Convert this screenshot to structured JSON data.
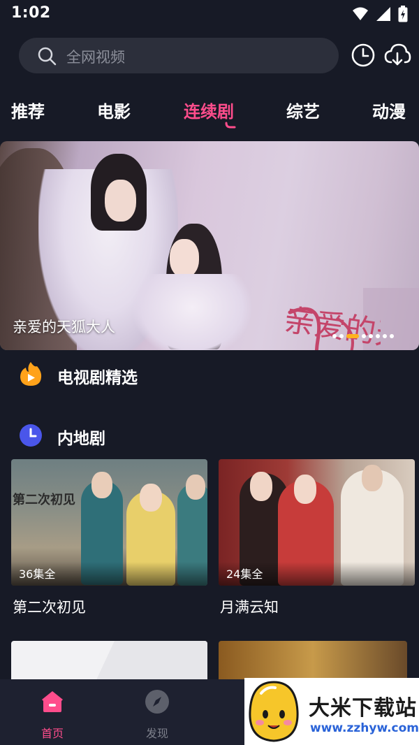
{
  "status_bar": {
    "time": "1:02"
  },
  "search": {
    "placeholder": "全网视频"
  },
  "tabs": [
    {
      "label": "推荐",
      "active": false
    },
    {
      "label": "电影",
      "active": false
    },
    {
      "label": "连续剧",
      "active": true
    },
    {
      "label": "综艺",
      "active": false
    },
    {
      "label": "动漫",
      "active": false
    }
  ],
  "banner": {
    "title": "亲爱的天狐大人",
    "art_title": "亲爱的天狐大人",
    "page_count": 8,
    "active_page": 3
  },
  "sections": [
    {
      "title": "电视剧精选",
      "icon": "flame-play-icon"
    },
    {
      "title": "内地剧",
      "icon": "clock-icon"
    }
  ],
  "cards": [
    {
      "title": "第二次初见",
      "badge": "36集全",
      "poster_text": "第二次初见"
    },
    {
      "title": "月满云知",
      "badge": "24集全"
    }
  ],
  "bottom_nav": [
    {
      "label": "首页",
      "icon": "home-icon",
      "active": true
    },
    {
      "label": "发现",
      "icon": "compass-icon",
      "active": false
    }
  ],
  "watermark": {
    "name": "大米下载站",
    "url": "www.zzhyw.com"
  },
  "colors": {
    "accent": "#ff4d8c",
    "background": "#171a26",
    "dot_active": "#ffb21e"
  }
}
